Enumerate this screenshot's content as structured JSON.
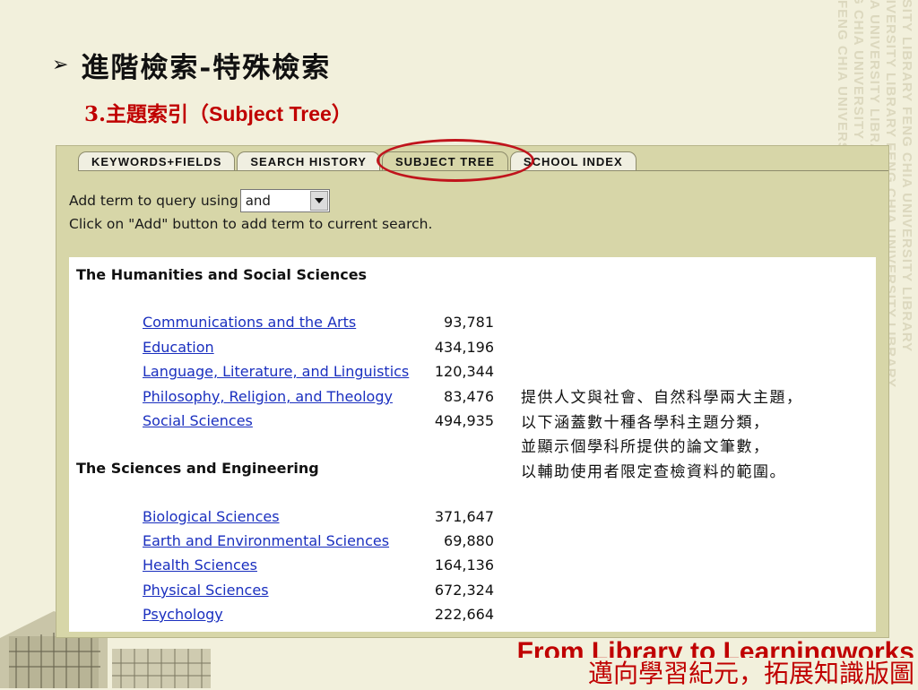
{
  "slide": {
    "bullet": "➢",
    "title": "進階檢索-特殊檢索",
    "subtitle_prefix": "3.主題索引（",
    "subtitle_en": "Subject Tree",
    "subtitle_suffix": "）"
  },
  "tabs": [
    {
      "label": "KEYWORDS+FIELDS"
    },
    {
      "label": "SEARCH HISTORY"
    },
    {
      "label": "SUBJECT TREE"
    },
    {
      "label": "SCHOOL INDEX"
    }
  ],
  "query": {
    "prefix": "Add term to query using",
    "operator": "and",
    "hint": "Click on \"Add\" button to add term to current search."
  },
  "sections": [
    {
      "heading": "The Humanities and Social Sciences",
      "items": [
        {
          "label": "Communications and the Arts",
          "count": "93,781"
        },
        {
          "label": "Education",
          "count": "434,196"
        },
        {
          "label": "Language, Literature, and Linguistics",
          "count": "120,344"
        },
        {
          "label": "Philosophy, Religion, and Theology",
          "count": "83,476"
        },
        {
          "label": "Social Sciences",
          "count": "494,935"
        }
      ]
    },
    {
      "heading": "The Sciences and Engineering",
      "items": [
        {
          "label": "Biological Sciences",
          "count": "371,647"
        },
        {
          "label": "Earth and Environmental Sciences",
          "count": "69,880"
        },
        {
          "label": "Health Sciences",
          "count": "164,136"
        },
        {
          "label": "Physical Sciences",
          "count": "672,324"
        },
        {
          "label": "Psychology",
          "count": "222,664"
        }
      ]
    }
  ],
  "note_lines": [
    "提供人文與社會、自然科學兩大主題，",
    "以下涵蓋數十種各學科主題分類，",
    "並顯示個學科所提供的論文筆數，",
    "以輔助使用者限定查檢資料的範圍。"
  ],
  "footer": {
    "slogan_en": "From Library to Learningworks",
    "slogan_zh": "邁向學習紀元，拓展知識版圖"
  },
  "watermark_text": "FENG CHIA UNIVERSITY LIBRARY FENG CHIA UNIVERSITY LIBRARY",
  "colors": {
    "title_red": "#c00000",
    "link_blue": "#1a2fbf",
    "panel_bg": "#d7d6a8",
    "highlight_ring": "#c0141c"
  }
}
